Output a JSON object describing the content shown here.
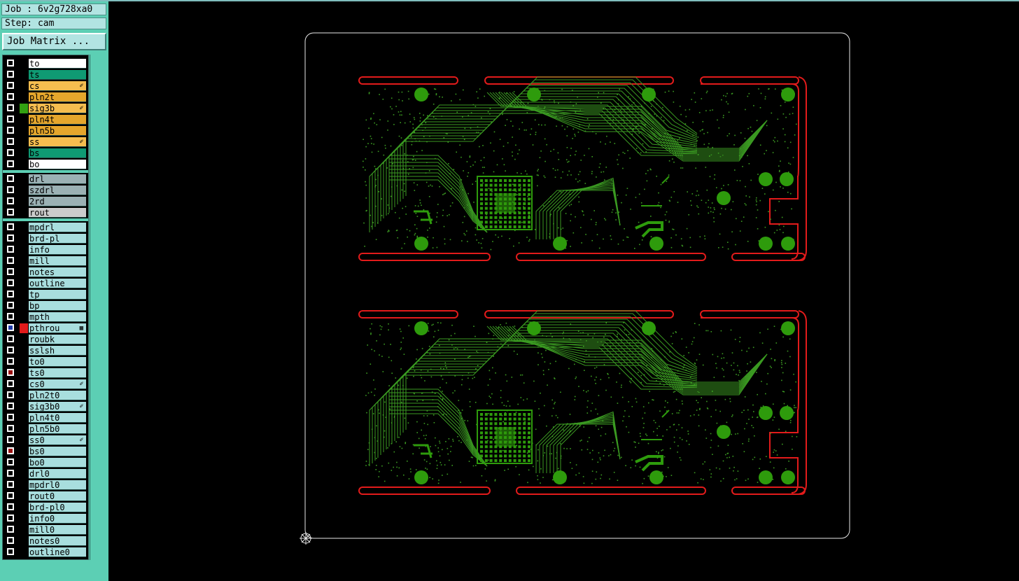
{
  "job_label": "Job : 6v2g728xa0",
  "step_label": "Step: cam",
  "matrix_button": "Job Matrix ...",
  "colors": {
    "panel_bg": "#5ccfb4",
    "row_default": "#a8dede",
    "green_layer": "#0f9a73",
    "signal_layer": "#f5bd4f",
    "plane_layer": "#e5a62c",
    "drill_layer": "#9bb1b4",
    "rout_layer": "#cccccc",
    "white_layer": "#ffffff",
    "board_trace": "#3b9a22",
    "board_pad": "#2e9b0c",
    "rout_outline": "#e21b1b"
  },
  "layers": [
    {
      "name": "to",
      "bg": "#ffffff"
    },
    {
      "name": "ts",
      "bg": "#0f9a73"
    },
    {
      "name": "cs",
      "bg": "#f5bd4f",
      "mark": "✐"
    },
    {
      "name": "pln2t",
      "bg": "#e5a62c"
    },
    {
      "name": "sig3b",
      "bg": "#f5bd4f",
      "mark": "✐",
      "swatch": "#32a112"
    },
    {
      "name": "pln4t",
      "bg": "#e5a62c"
    },
    {
      "name": "pln5b",
      "bg": "#e5a62c"
    },
    {
      "name": "ss",
      "bg": "#f5bd4f",
      "mark": "✐"
    },
    {
      "name": "bs",
      "bg": "#0f9a73"
    },
    {
      "name": "bo",
      "bg": "#ffffff",
      "group_end": true
    },
    {
      "name": "drl",
      "bg": "#9bb1b4"
    },
    {
      "name": "szdrl",
      "bg": "#9bb1b4"
    },
    {
      "name": "2rd",
      "bg": "#9bb1b4"
    },
    {
      "name": "rout",
      "bg": "#cccccc",
      "group_end": true
    },
    {
      "name": "mpdrl",
      "bg": "#a8dede"
    },
    {
      "name": "brd-pl",
      "bg": "#a8dede"
    },
    {
      "name": "info",
      "bg": "#a8dede"
    },
    {
      "name": "mill",
      "bg": "#a8dede"
    },
    {
      "name": "notes",
      "bg": "#a8dede"
    },
    {
      "name": "outline",
      "bg": "#a8dede"
    },
    {
      "name": "tp",
      "bg": "#a8dede"
    },
    {
      "name": "bp",
      "bg": "#a8dede"
    },
    {
      "name": "mpth",
      "bg": "#a8dede"
    },
    {
      "name": "pthrou",
      "bg": "#a8dede",
      "mark": "▦",
      "swatch": "#e21b1b",
      "active": true
    },
    {
      "name": "roubk",
      "bg": "#a8dede"
    },
    {
      "name": "sslsh",
      "bg": "#a8dede"
    },
    {
      "name": "to0",
      "bg": "#a8dede"
    },
    {
      "name": "ts0",
      "bg": "#a8dede",
      "flag": "red"
    },
    {
      "name": "cs0",
      "bg": "#a8dede",
      "mark": "✐"
    },
    {
      "name": "pln2t0",
      "bg": "#a8dede"
    },
    {
      "name": "sig3b0",
      "bg": "#a8dede",
      "mark": "✐"
    },
    {
      "name": "pln4t0",
      "bg": "#a8dede"
    },
    {
      "name": "pln5b0",
      "bg": "#a8dede"
    },
    {
      "name": "ss0",
      "bg": "#a8dede",
      "mark": "✐"
    },
    {
      "name": "bs0",
      "bg": "#a8dede",
      "flag": "red"
    },
    {
      "name": "bo0",
      "bg": "#a8dede"
    },
    {
      "name": "drl0",
      "bg": "#a8dede"
    },
    {
      "name": "mpdrl0",
      "bg": "#a8dede"
    },
    {
      "name": "rout0",
      "bg": "#a8dede"
    },
    {
      "name": "brd-pl0",
      "bg": "#a8dede"
    },
    {
      "name": "info0",
      "bg": "#a8dede"
    },
    {
      "name": "mill0",
      "bg": "#a8dede"
    },
    {
      "name": "notes0",
      "bg": "#a8dede"
    },
    {
      "name": "outline0",
      "bg": "#a8dede"
    }
  ],
  "icons": {
    "edit_mark": "pencil-icon",
    "origin": "origin-crosshair-icon",
    "feature_mark": "grid-icon"
  }
}
